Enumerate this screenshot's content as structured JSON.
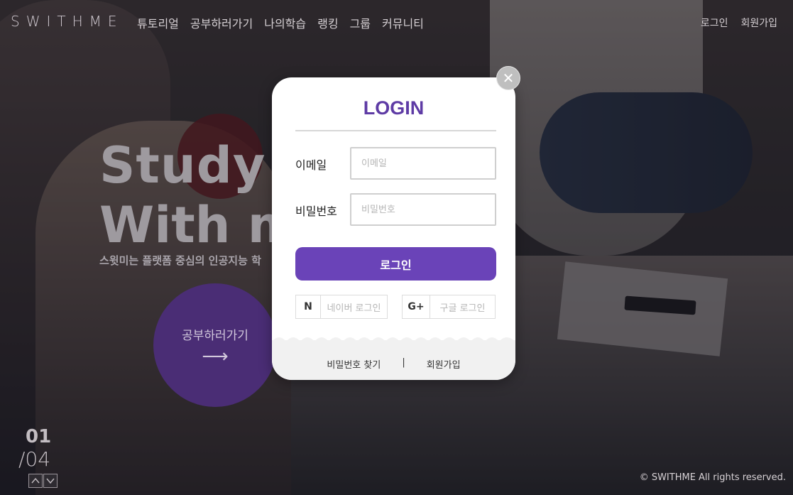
{
  "header": {
    "logo": "SWITHME",
    "nav": [
      "튜토리얼",
      "공부하러가기",
      "나의학습",
      "랭킹",
      "그룹",
      "커뮤니티"
    ],
    "login_link": "로그인",
    "signup_link": "회원가입"
  },
  "hero": {
    "line1": "Study",
    "line2": "With m",
    "subtitle": "스윗미는 플랫폼 중심의 인공지능 학",
    "cta_label": "공부하러가기",
    "cta_arrow": "⟶"
  },
  "slider": {
    "current": "01",
    "total": "/04",
    "up_icon": "^",
    "down_icon": "v"
  },
  "footer": {
    "copyright": "© SWITHME All rights reserved."
  },
  "modal": {
    "close_icon": "✕",
    "title": "LOGIN",
    "email_label": "이메일",
    "email_placeholder": "이메일",
    "email_value": "",
    "password_label": "비밀번호",
    "password_placeholder": "비밀번호",
    "password_value": "",
    "login_button": "로그인",
    "naver": {
      "icon_text": "N",
      "label": "네이버 로그인"
    },
    "google": {
      "icon_text": "G+",
      "label": "구글 로그인"
    },
    "find_password": "비밀번호 찾기",
    "separator": "|",
    "signup": "회원가입"
  },
  "colors": {
    "accent": "#6a43b8",
    "title": "#5e3ba5",
    "cta_circle": "#4a2d75"
  }
}
